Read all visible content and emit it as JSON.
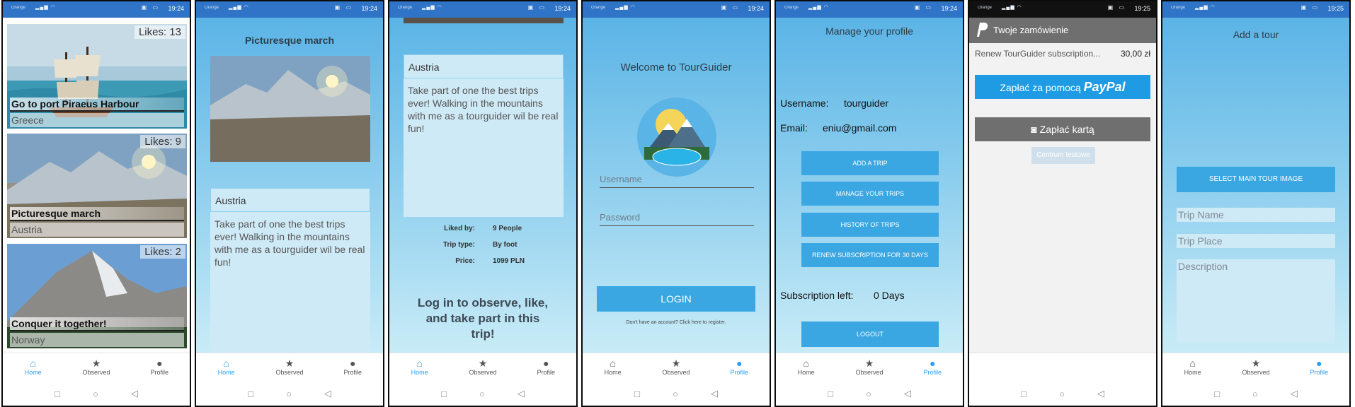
{
  "status": {
    "carrier": "Orange",
    "times": [
      "19:24",
      "19:24",
      "19:24",
      "19:24",
      "19:24",
      "19:25",
      "19:25"
    ]
  },
  "nav": {
    "home": "Home",
    "observed": "Observed",
    "profile": "Profile"
  },
  "list": {
    "tours": [
      {
        "likes": "Likes: 13",
        "title": "Go to port Piraeus Harbour",
        "place": "Greece"
      },
      {
        "likes": "Likes: 9",
        "title": "Picturesque march",
        "place": "Austria"
      },
      {
        "likes": "Likes: 2",
        "title": "Conquer it together!",
        "place": "Norway"
      }
    ]
  },
  "detail": {
    "title": "Picturesque march",
    "place": "Austria",
    "description": "Take part of one the best trips ever! Walking in the mountains with me as a tourguider wil be real fun!",
    "liked_by_label": "Liked by:",
    "liked_by": "9 People",
    "type_label": "Trip type:",
    "type": "By foot",
    "price_label": "Price:",
    "price": "1099 PLN",
    "login_prompt": "Log in to observe, like, and take part in this trip!"
  },
  "login": {
    "welcome": "Welcome to TourGuider",
    "username_placeholder": "Username",
    "password_placeholder": "Password",
    "login_label": "LOGIN",
    "register_text": "Don't have an account? Click here to register."
  },
  "profile": {
    "title": "Manage your profile",
    "username_label": "Username:",
    "username": "tourguider",
    "email_label": "Email:",
    "email": "eniu@gmail.com",
    "buttons": [
      "ADD A TRIP",
      "MANAGE YOUR TRIPS",
      "HISTORY OF TRIPS",
      "RENEW SUBSCRIPTION FOR 30 DAYS"
    ],
    "subscription_label": "Subscription left:",
    "subscription": "0 Days",
    "logout": "LOGOUT"
  },
  "paypal": {
    "header": "Twoje zamówienie",
    "item": "Renew TourGuider subscription...",
    "amount": "30,00 zł",
    "pay_paypal_prefix": "Zapłać za pomocą",
    "paypal_brand": "PayPal",
    "pay_card": "Zapłać kartą",
    "test_center": "Centrum testowe"
  },
  "add_tour": {
    "title": "Add a tour",
    "select_image": "SELECT MAIN TOUR IMAGE",
    "trip_name": "Trip Name",
    "trip_place": "Trip Place",
    "description": "Description"
  },
  "colors": {
    "accent": "#3aa7e3",
    "statusbar": "#2f74c7",
    "active_nav": "#2a9df4"
  }
}
